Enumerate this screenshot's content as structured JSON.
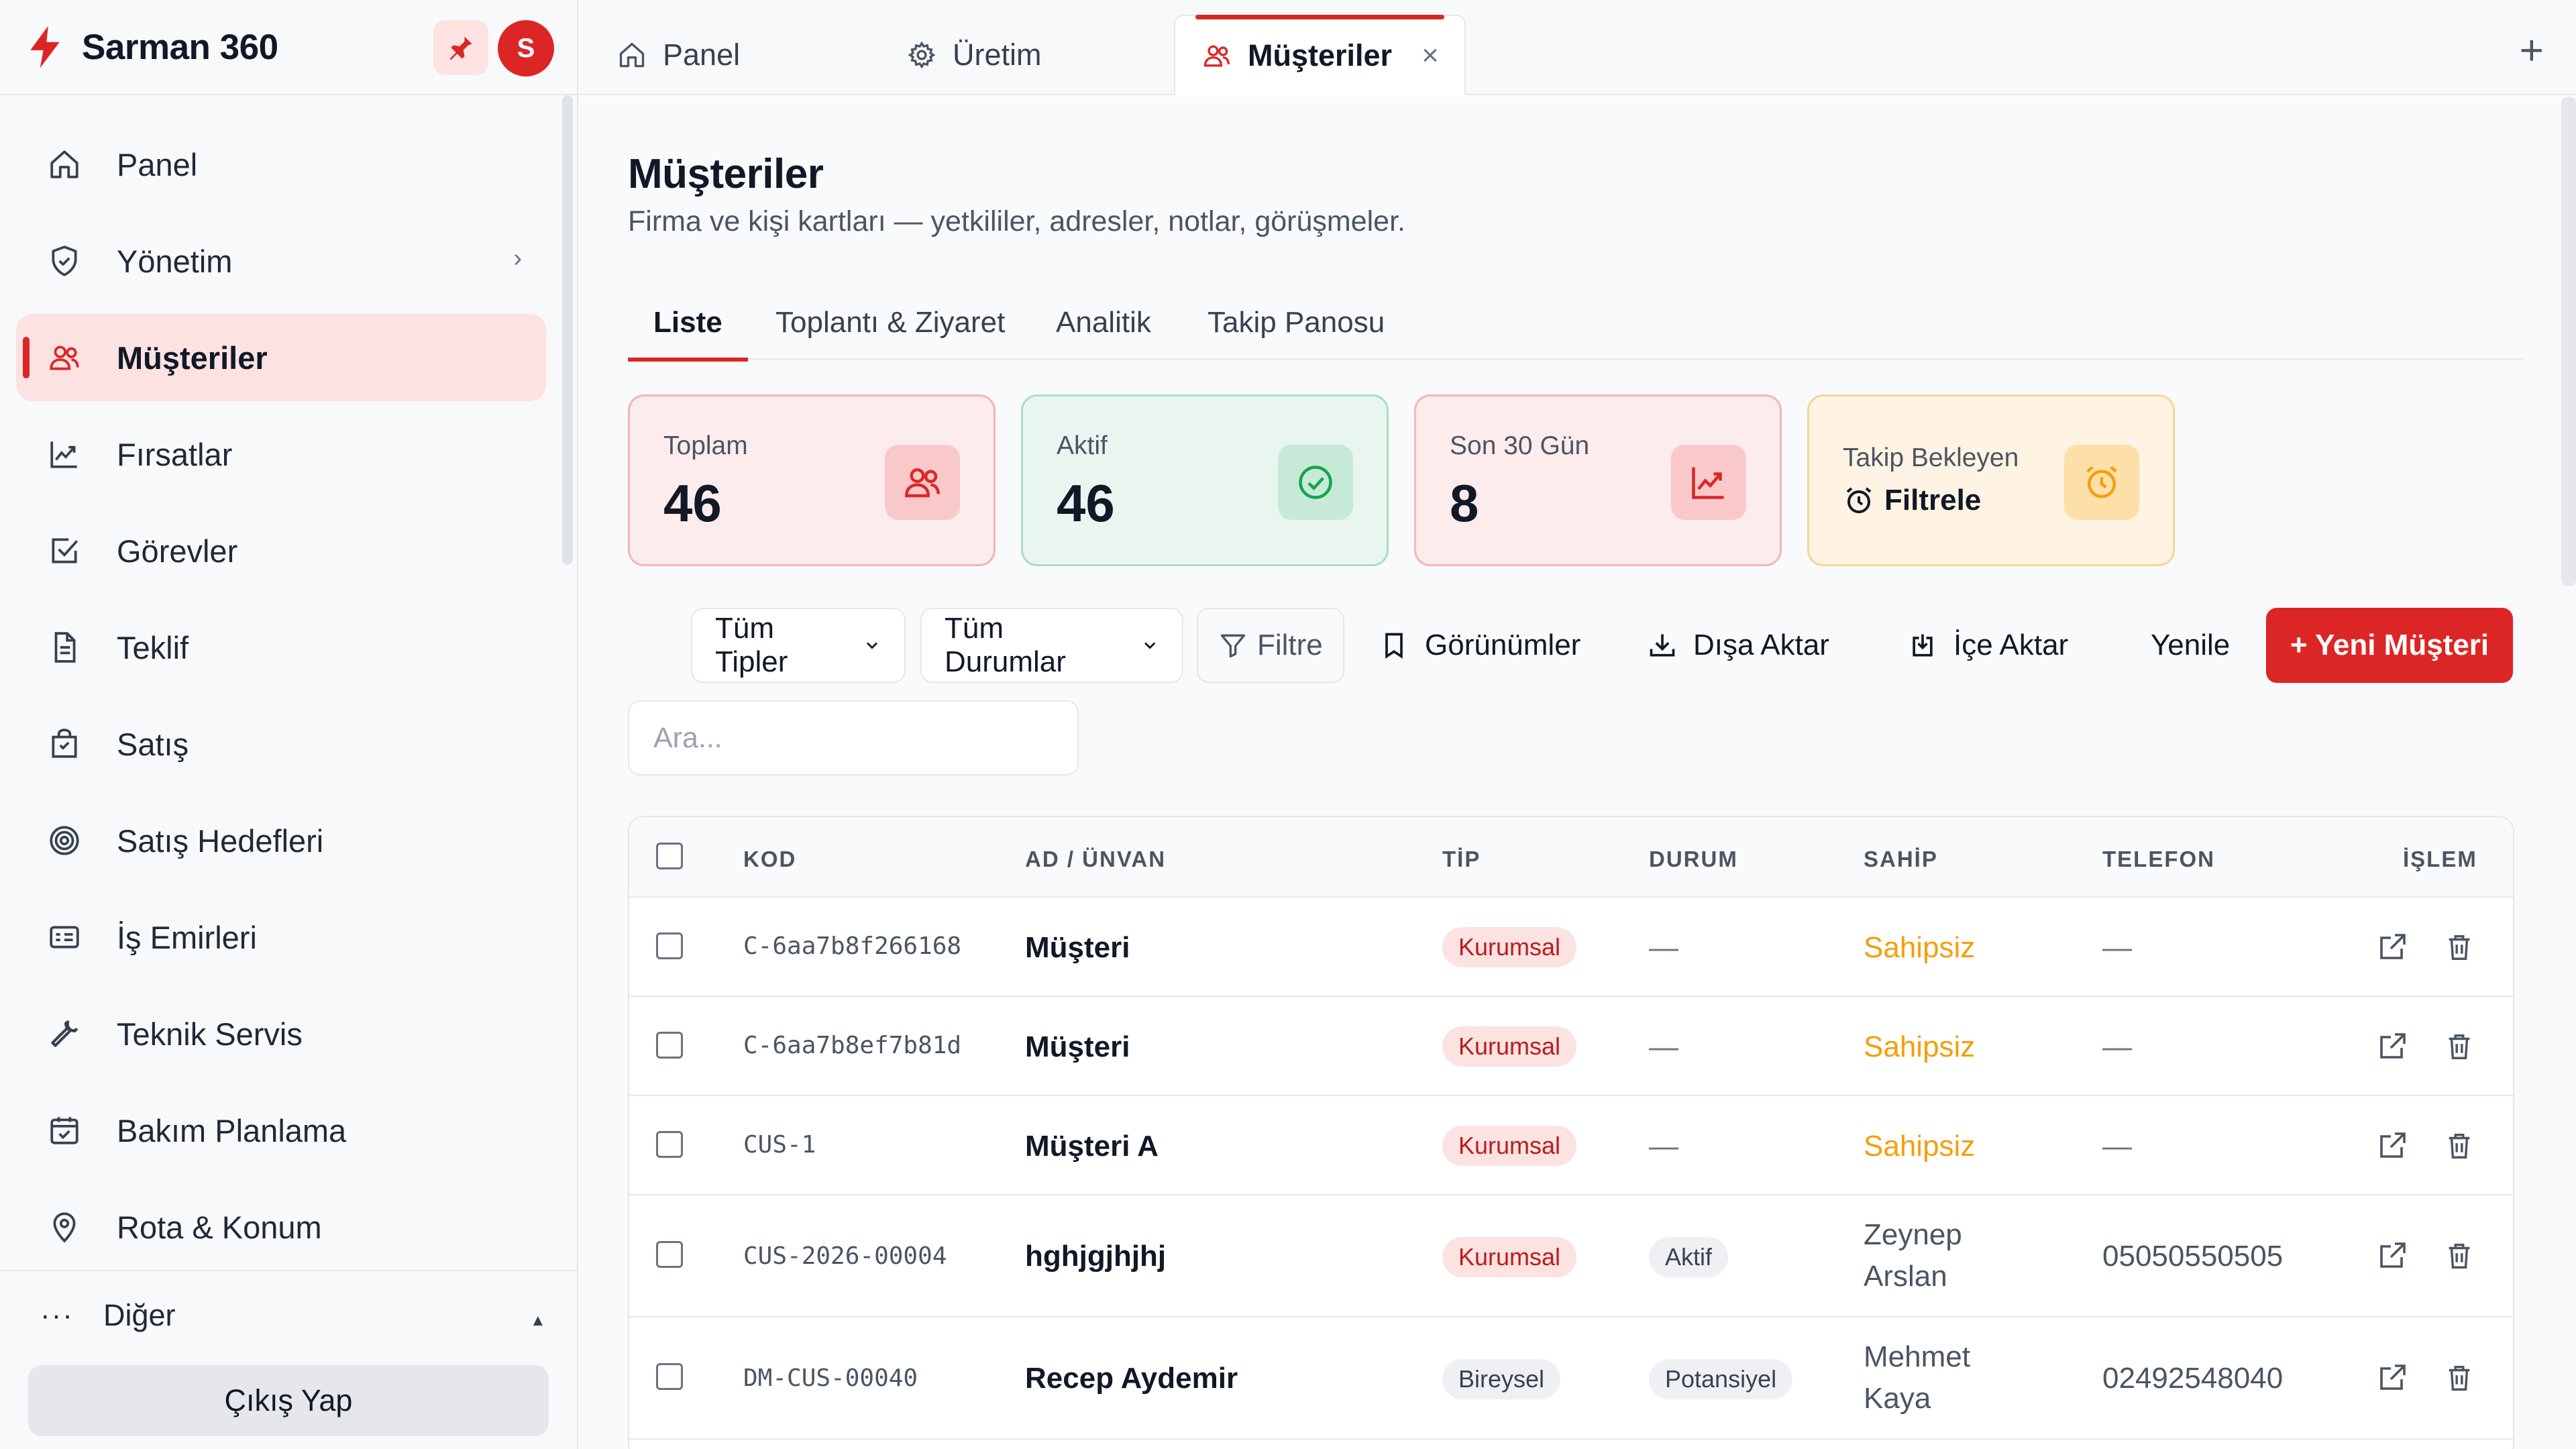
{
  "brand": {
    "name": "Sarman 360",
    "avatar_letter": "S"
  },
  "sidebar": {
    "items": [
      {
        "label": "Panel",
        "icon": "home-icon"
      },
      {
        "label": "Yönetim",
        "icon": "shield-icon",
        "chevron": "›"
      },
      {
        "label": "Müşteriler",
        "icon": "users-icon",
        "active": true
      },
      {
        "label": "Fırsatlar",
        "icon": "chart-line-icon"
      },
      {
        "label": "Görevler",
        "icon": "checkbox-icon"
      },
      {
        "label": "Teklif",
        "icon": "document-icon"
      },
      {
        "label": "Satış",
        "icon": "shopping-bag-icon"
      },
      {
        "label": "Satış Hedefleri",
        "icon": "target-icon"
      },
      {
        "label": "İş Emirleri",
        "icon": "id-card-icon"
      },
      {
        "label": "Teknik Servis",
        "icon": "wrench-icon"
      },
      {
        "label": "Bakım Planlama",
        "icon": "calendar-check-icon"
      },
      {
        "label": "Rota & Konum",
        "icon": "map-pin-icon"
      }
    ],
    "more": {
      "dots": "···",
      "label": "Diğer",
      "caret": "▲"
    },
    "logout_label": "Çıkış Yap"
  },
  "tabs": [
    {
      "label": "Panel",
      "icon": "home-icon"
    },
    {
      "label": "Üretim",
      "icon": "gear-icon"
    },
    {
      "label": "Müşteriler",
      "icon": "users-icon",
      "active": true,
      "close": "×"
    }
  ],
  "tabs_plus": "+",
  "page": {
    "title": "Müşteriler",
    "subtitle": "Firma ve kişi kartları — yetkililer, adresler, notlar, görüşmeler."
  },
  "subtabs": [
    {
      "label": "Liste",
      "active": true
    },
    {
      "label": "Toplantı & Ziyaret"
    },
    {
      "label": "Analitik"
    },
    {
      "label": "Takip Panosu"
    }
  ],
  "kpis": [
    {
      "label": "Toplam",
      "value": "46",
      "icon": "users-icon",
      "color": "#dc2626"
    },
    {
      "label": "Aktif",
      "value": "46",
      "icon": "check-circle-icon",
      "color": "#16a34a"
    },
    {
      "label": "Son 30 Gün",
      "value": "8",
      "icon": "chart-line-icon",
      "color": "#dc2626"
    },
    {
      "label": "Takip Bekleyen",
      "action": "Filtrele",
      "icon": "alarm-clock-icon",
      "color": "#f59e0b"
    }
  ],
  "toolbar": {
    "type_select": "Tüm Tipler",
    "status_select": "Tüm Durumlar",
    "filter_label": "Filtre",
    "views_label": "Görünümler",
    "export_label": "Dışa Aktar",
    "import_label": "İçe Aktar",
    "refresh_label": "Yenile",
    "new_label": "+ Yeni Müşteri"
  },
  "search": {
    "placeholder": "Ara...",
    "value": ""
  },
  "table": {
    "columns": [
      "KOD",
      "AD / ÜNVAN",
      "TİP",
      "DURUM",
      "SAHİP",
      "TELEFON",
      "İŞLEM"
    ],
    "rows": [
      {
        "code": "C-6aa7b8f266168",
        "name": "Müşteri",
        "type": "Kurumsal",
        "status": "—",
        "owner": "Sahipsiz",
        "owner_line2": "",
        "phone": "—"
      },
      {
        "code": "C-6aa7b8ef7b81d",
        "name": "Müşteri",
        "type": "Kurumsal",
        "status": "—",
        "owner": "Sahipsiz",
        "owner_line2": "",
        "phone": "—"
      },
      {
        "code": "CUS-1",
        "name": "Müşteri A",
        "type": "Kurumsal",
        "status": "—",
        "owner": "Sahipsiz",
        "owner_line2": "",
        "phone": "—"
      },
      {
        "code": "CUS-2026-00004",
        "name": "hghjgjhjhj",
        "type": "Kurumsal",
        "status": "Aktif",
        "owner": "Zeynep",
        "owner_line2": "Arslan",
        "phone": "05050550505"
      },
      {
        "code": "DM-CUS-00040",
        "name": "Recep Aydemir",
        "type": "Bireysel",
        "status": "Potansiyel",
        "owner": "Mehmet",
        "owner_line2": "Kaya",
        "phone": "02492548040"
      }
    ]
  },
  "colors": {
    "accent": "#dc2626",
    "owner_unassigned": "#f59e0b"
  }
}
